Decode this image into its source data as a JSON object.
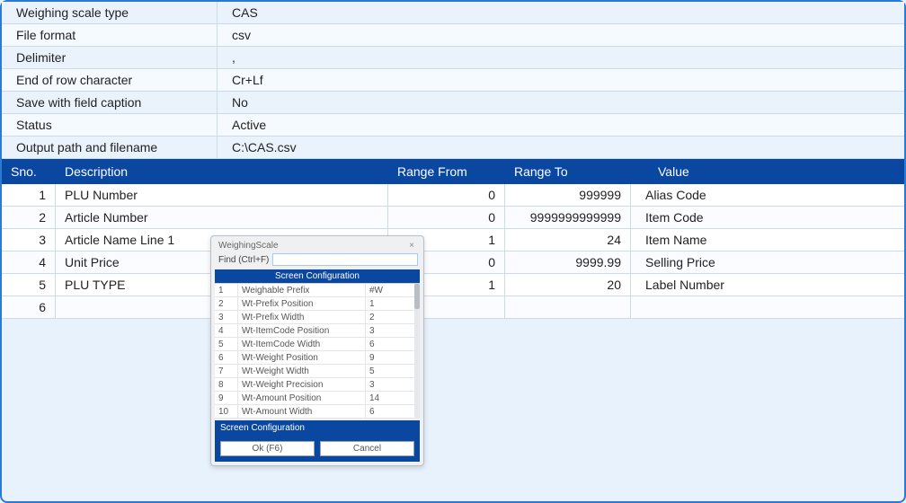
{
  "settings": [
    {
      "label": "Weighing scale type",
      "value": "CAS"
    },
    {
      "label": "File format",
      "value": "csv"
    },
    {
      "label": "Delimiter",
      "value": ","
    },
    {
      "label": "End of row character",
      "value": "Cr+Lf"
    },
    {
      "label": "Save with field caption",
      "value": "No"
    },
    {
      "label": "Status",
      "value": "Active"
    },
    {
      "label": "Output path and filename",
      "value": "C:\\CAS.csv"
    }
  ],
  "grid": {
    "headers": {
      "sno": "Sno.",
      "desc": "Description",
      "rfrom": "Range From",
      "rto": "Range To",
      "value": "Value"
    },
    "rows": [
      {
        "sno": "1",
        "desc": "PLU Number",
        "rfrom": "0",
        "rto": "999999",
        "value": "Alias Code"
      },
      {
        "sno": "2",
        "desc": "Article Number",
        "rfrom": "0",
        "rto": "9999999999999",
        "value": "Item Code"
      },
      {
        "sno": "3",
        "desc": "Article Name Line 1",
        "rfrom": "1",
        "rto": "24",
        "value": "Item Name"
      },
      {
        "sno": "4",
        "desc": "Unit Price",
        "rfrom": "0",
        "rto": "9999.99",
        "value": "Selling Price"
      },
      {
        "sno": "5",
        "desc": "PLU TYPE",
        "rfrom": "1",
        "rto": "20",
        "value": "Label Number"
      },
      {
        "sno": "6",
        "desc": "",
        "rfrom": "",
        "rto": "",
        "value": ""
      }
    ]
  },
  "dialog": {
    "title": "WeighingScale",
    "find_label": "Find (Ctrl+F)",
    "find_value": "",
    "section_header": "Screen Configuration",
    "items": [
      {
        "no": "1",
        "name": "Weighable Prefix",
        "val": "#W"
      },
      {
        "no": "2",
        "name": "Wt-Prefix Position",
        "val": "1"
      },
      {
        "no": "3",
        "name": "Wt-Prefix Width",
        "val": "2"
      },
      {
        "no": "4",
        "name": "Wt-ItemCode Position",
        "val": "3"
      },
      {
        "no": "5",
        "name": "Wt-ItemCode Width",
        "val": "6"
      },
      {
        "no": "6",
        "name": "Wt-Weight Position",
        "val": "9"
      },
      {
        "no": "7",
        "name": "Wt-Weight Width",
        "val": "5"
      },
      {
        "no": "8",
        "name": "Wt-Weight Precision",
        "val": "3"
      },
      {
        "no": "9",
        "name": "Wt-Amount Position",
        "val": "14"
      },
      {
        "no": "10",
        "name": "Wt-Amount Width",
        "val": "6"
      }
    ],
    "footer_label": "Screen Configuration",
    "ok_label": "Ok (F6)",
    "cancel_label": "Cancel"
  }
}
